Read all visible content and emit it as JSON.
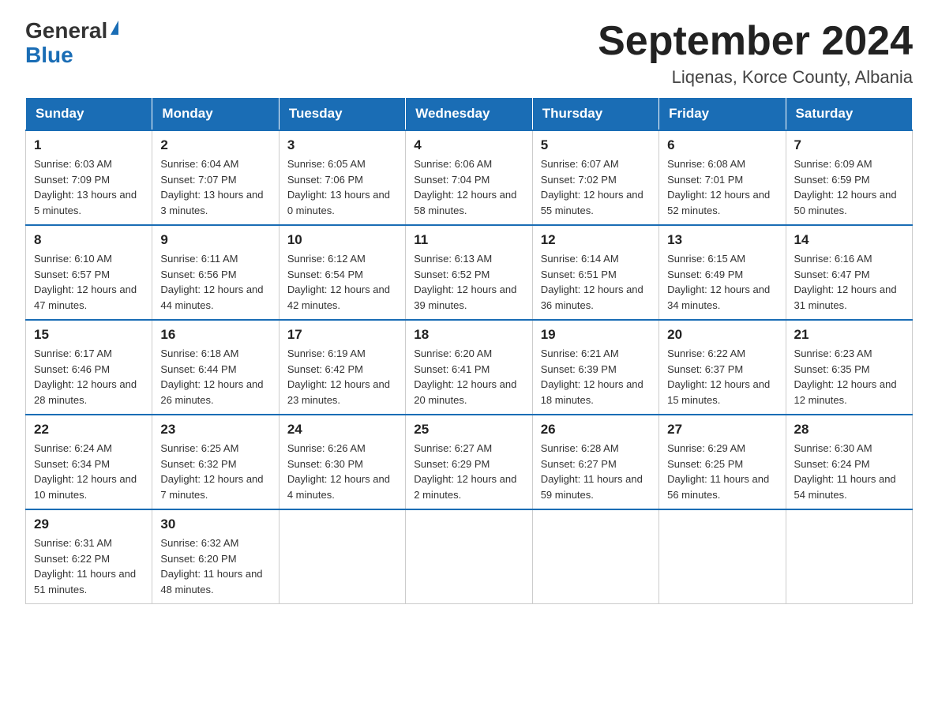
{
  "logo": {
    "general": "General",
    "blue": "Blue"
  },
  "title": "September 2024",
  "subtitle": "Liqenas, Korce County, Albania",
  "weekdays": [
    "Sunday",
    "Monday",
    "Tuesday",
    "Wednesday",
    "Thursday",
    "Friday",
    "Saturday"
  ],
  "weeks": [
    [
      {
        "day": "1",
        "sunrise": "6:03 AM",
        "sunset": "7:09 PM",
        "daylight": "13 hours and 5 minutes."
      },
      {
        "day": "2",
        "sunrise": "6:04 AM",
        "sunset": "7:07 PM",
        "daylight": "13 hours and 3 minutes."
      },
      {
        "day": "3",
        "sunrise": "6:05 AM",
        "sunset": "7:06 PM",
        "daylight": "13 hours and 0 minutes."
      },
      {
        "day": "4",
        "sunrise": "6:06 AM",
        "sunset": "7:04 PM",
        "daylight": "12 hours and 58 minutes."
      },
      {
        "day": "5",
        "sunrise": "6:07 AM",
        "sunset": "7:02 PM",
        "daylight": "12 hours and 55 minutes."
      },
      {
        "day": "6",
        "sunrise": "6:08 AM",
        "sunset": "7:01 PM",
        "daylight": "12 hours and 52 minutes."
      },
      {
        "day": "7",
        "sunrise": "6:09 AM",
        "sunset": "6:59 PM",
        "daylight": "12 hours and 50 minutes."
      }
    ],
    [
      {
        "day": "8",
        "sunrise": "6:10 AM",
        "sunset": "6:57 PM",
        "daylight": "12 hours and 47 minutes."
      },
      {
        "day": "9",
        "sunrise": "6:11 AM",
        "sunset": "6:56 PM",
        "daylight": "12 hours and 44 minutes."
      },
      {
        "day": "10",
        "sunrise": "6:12 AM",
        "sunset": "6:54 PM",
        "daylight": "12 hours and 42 minutes."
      },
      {
        "day": "11",
        "sunrise": "6:13 AM",
        "sunset": "6:52 PM",
        "daylight": "12 hours and 39 minutes."
      },
      {
        "day": "12",
        "sunrise": "6:14 AM",
        "sunset": "6:51 PM",
        "daylight": "12 hours and 36 minutes."
      },
      {
        "day": "13",
        "sunrise": "6:15 AM",
        "sunset": "6:49 PM",
        "daylight": "12 hours and 34 minutes."
      },
      {
        "day": "14",
        "sunrise": "6:16 AM",
        "sunset": "6:47 PM",
        "daylight": "12 hours and 31 minutes."
      }
    ],
    [
      {
        "day": "15",
        "sunrise": "6:17 AM",
        "sunset": "6:46 PM",
        "daylight": "12 hours and 28 minutes."
      },
      {
        "day": "16",
        "sunrise": "6:18 AM",
        "sunset": "6:44 PM",
        "daylight": "12 hours and 26 minutes."
      },
      {
        "day": "17",
        "sunrise": "6:19 AM",
        "sunset": "6:42 PM",
        "daylight": "12 hours and 23 minutes."
      },
      {
        "day": "18",
        "sunrise": "6:20 AM",
        "sunset": "6:41 PM",
        "daylight": "12 hours and 20 minutes."
      },
      {
        "day": "19",
        "sunrise": "6:21 AM",
        "sunset": "6:39 PM",
        "daylight": "12 hours and 18 minutes."
      },
      {
        "day": "20",
        "sunrise": "6:22 AM",
        "sunset": "6:37 PM",
        "daylight": "12 hours and 15 minutes."
      },
      {
        "day": "21",
        "sunrise": "6:23 AM",
        "sunset": "6:35 PM",
        "daylight": "12 hours and 12 minutes."
      }
    ],
    [
      {
        "day": "22",
        "sunrise": "6:24 AM",
        "sunset": "6:34 PM",
        "daylight": "12 hours and 10 minutes."
      },
      {
        "day": "23",
        "sunrise": "6:25 AM",
        "sunset": "6:32 PM",
        "daylight": "12 hours and 7 minutes."
      },
      {
        "day": "24",
        "sunrise": "6:26 AM",
        "sunset": "6:30 PM",
        "daylight": "12 hours and 4 minutes."
      },
      {
        "day": "25",
        "sunrise": "6:27 AM",
        "sunset": "6:29 PM",
        "daylight": "12 hours and 2 minutes."
      },
      {
        "day": "26",
        "sunrise": "6:28 AM",
        "sunset": "6:27 PM",
        "daylight": "11 hours and 59 minutes."
      },
      {
        "day": "27",
        "sunrise": "6:29 AM",
        "sunset": "6:25 PM",
        "daylight": "11 hours and 56 minutes."
      },
      {
        "day": "28",
        "sunrise": "6:30 AM",
        "sunset": "6:24 PM",
        "daylight": "11 hours and 54 minutes."
      }
    ],
    [
      {
        "day": "29",
        "sunrise": "6:31 AM",
        "sunset": "6:22 PM",
        "daylight": "11 hours and 51 minutes."
      },
      {
        "day": "30",
        "sunrise": "6:32 AM",
        "sunset": "6:20 PM",
        "daylight": "11 hours and 48 minutes."
      },
      null,
      null,
      null,
      null,
      null
    ]
  ]
}
